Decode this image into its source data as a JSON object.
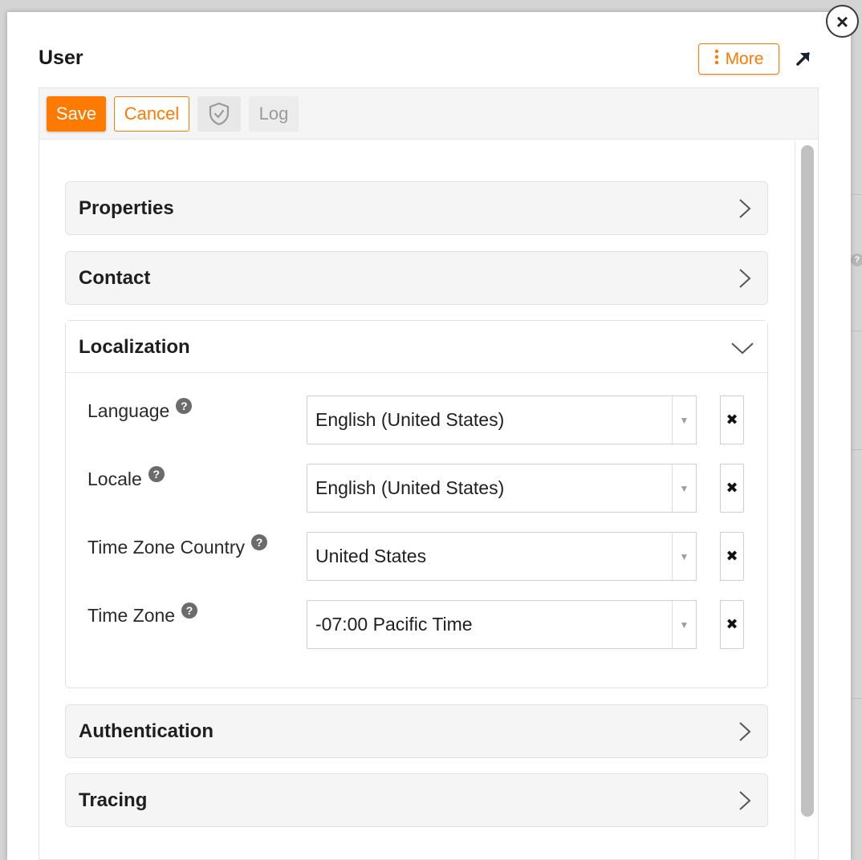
{
  "dialog": {
    "title": "User",
    "more_label": "More",
    "more_icon": "vertical-dots-icon",
    "expand_icon": "arrow-up-right-icon",
    "close_icon": "close-icon",
    "close_glyph": "×"
  },
  "toolbar": {
    "save_label": "Save",
    "cancel_label": "Cancel",
    "shield_icon": "shield-check-icon",
    "log_label": "Log"
  },
  "sections": {
    "properties": {
      "title": "Properties",
      "expanded": false
    },
    "contact": {
      "title": "Contact",
      "expanded": false
    },
    "localization": {
      "title": "Localization",
      "expanded": true,
      "fields": [
        {
          "label": "Language",
          "value": "English (United States)"
        },
        {
          "label": "Locale",
          "value": "English (United States)"
        },
        {
          "label": "Time Zone Country",
          "value": "United States"
        },
        {
          "label": "Time Zone",
          "value": "-07:00 Pacific Time"
        }
      ]
    },
    "authentication": {
      "title": "Authentication",
      "expanded": false
    },
    "tracing": {
      "title": "Tracing",
      "expanded": false
    }
  },
  "glyphs": {
    "help": "?",
    "caret": "▼",
    "clear": "✖"
  },
  "colors": {
    "accent": "#ff7a00",
    "section_bg": "#f5f5f5",
    "text": "#1f1f1f"
  }
}
